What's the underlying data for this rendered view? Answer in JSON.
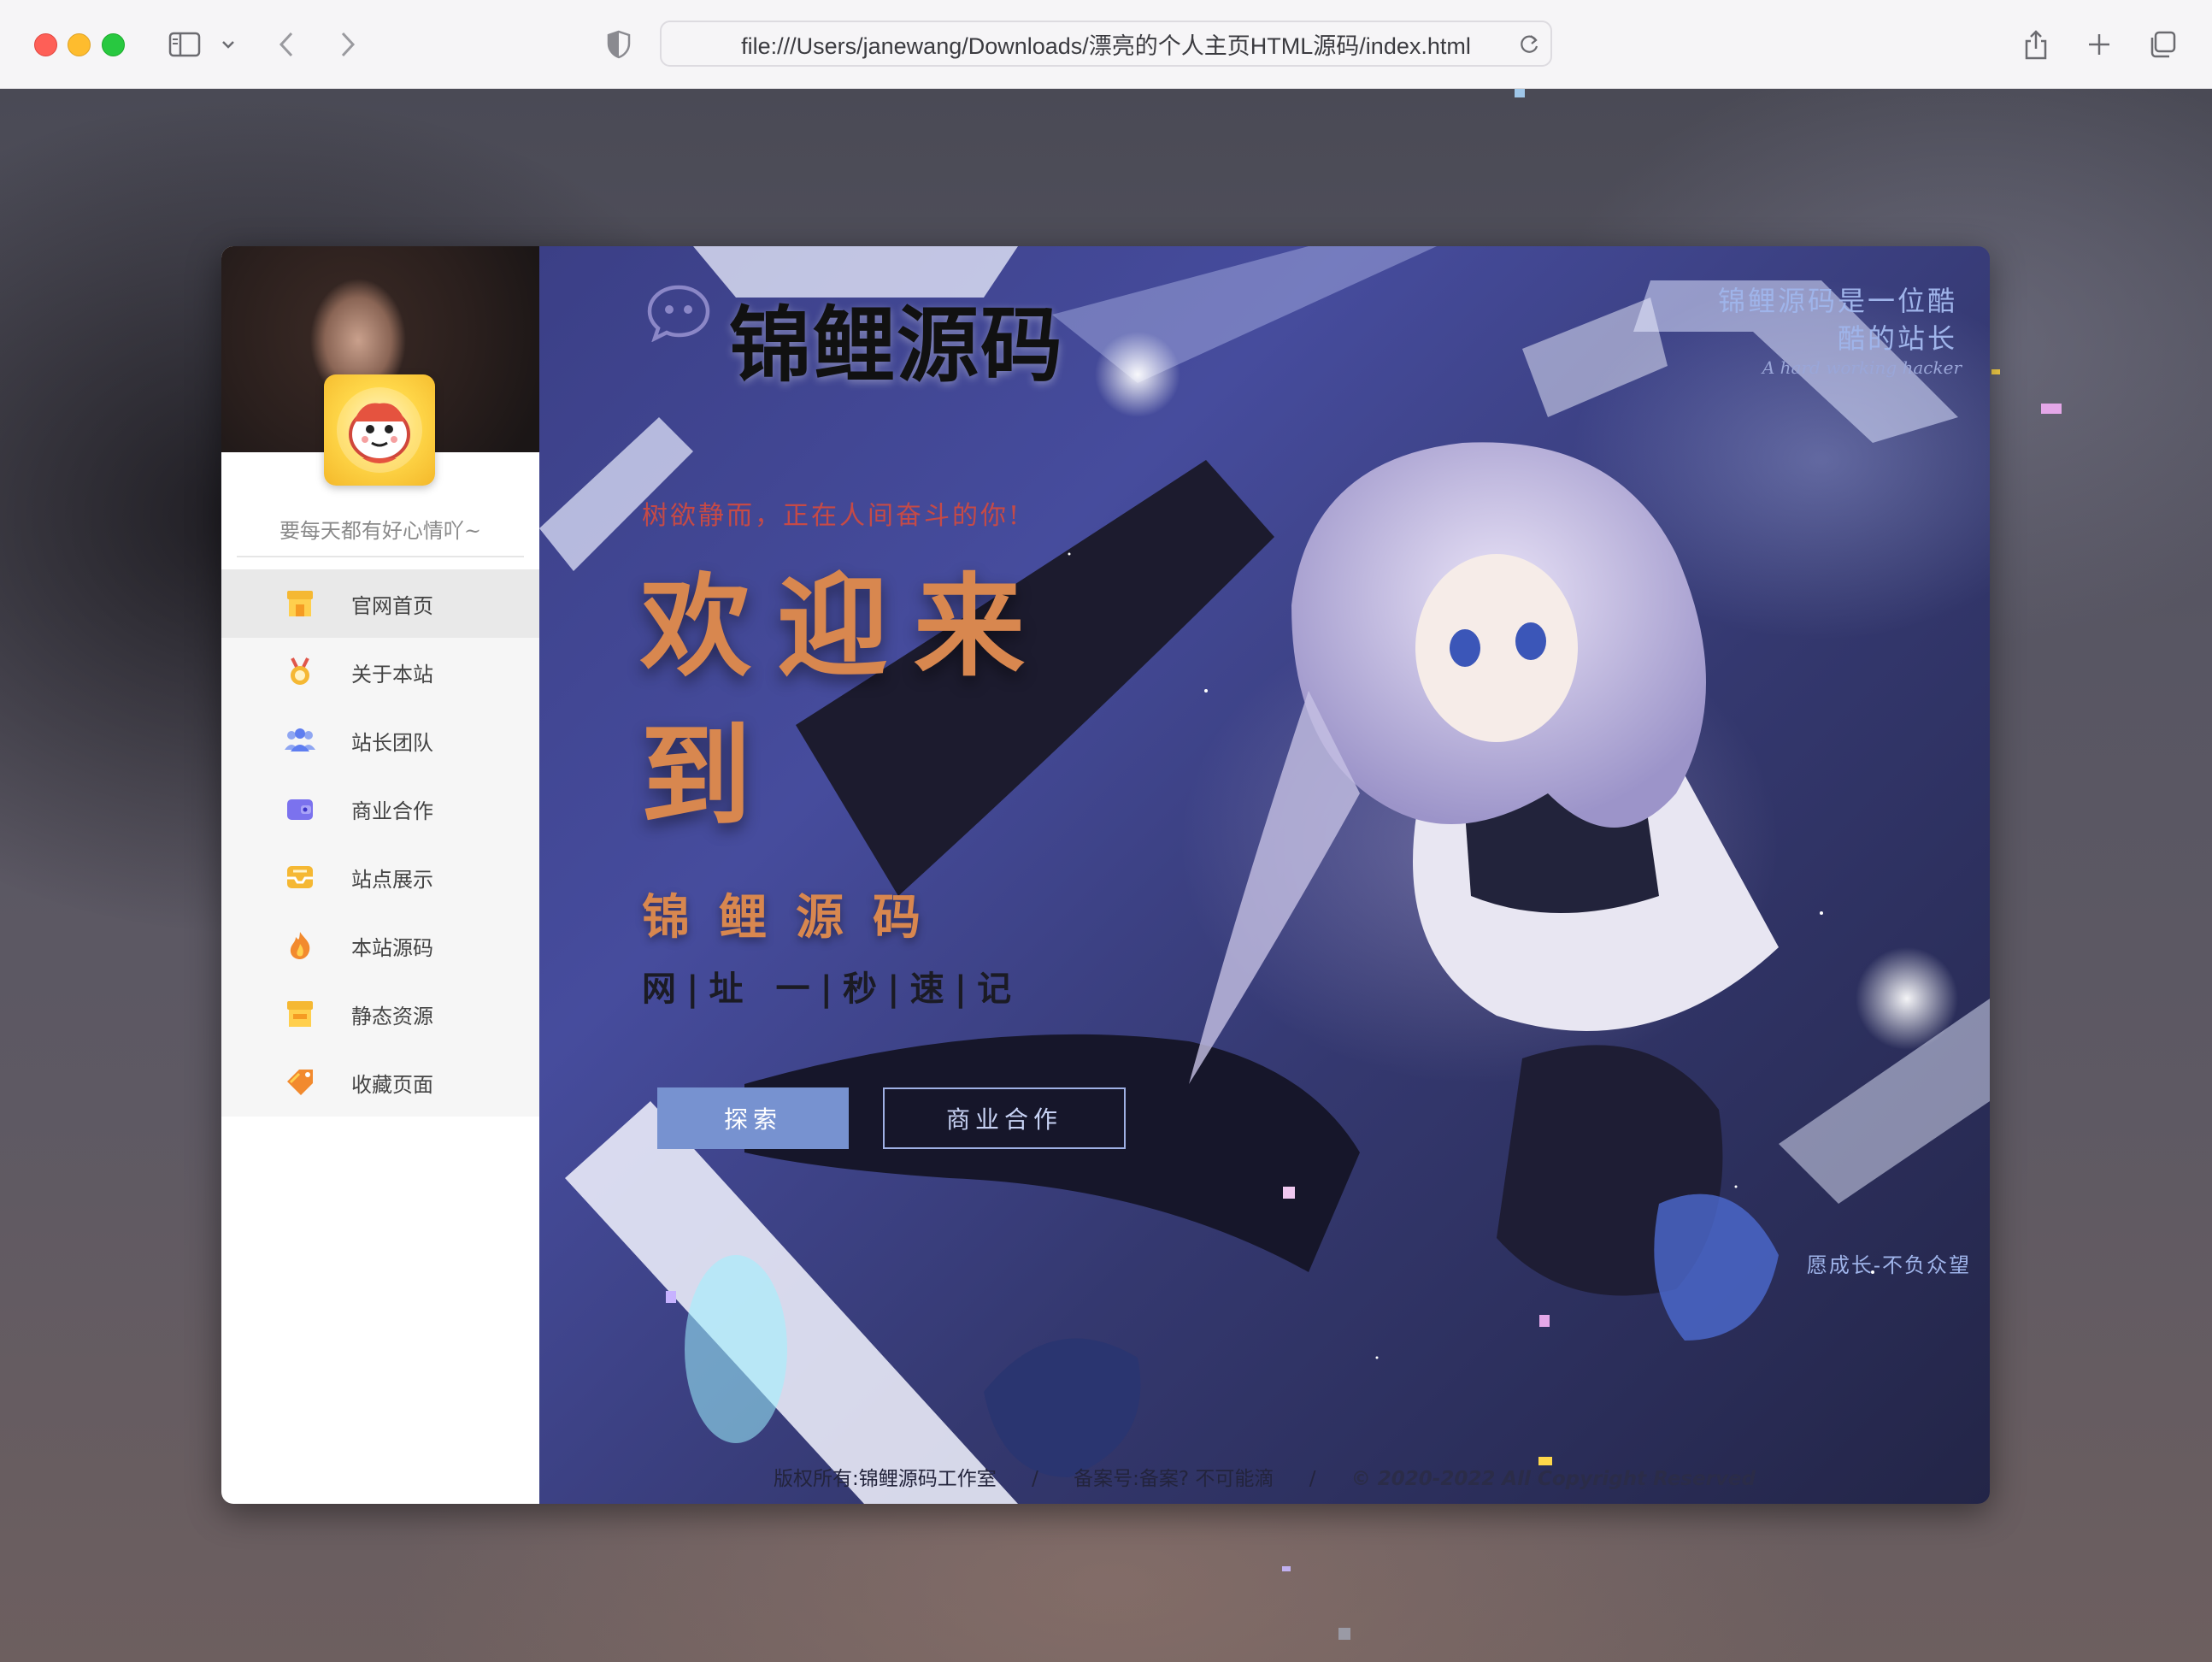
{
  "browser": {
    "url": "file:///Users/janewang/Downloads/漂亮的个人主页HTML源码/index.html"
  },
  "sidebar": {
    "slogan": "要每天都有好心情吖~",
    "items": [
      {
        "label": "官网首页",
        "icon": "shop-icon",
        "active": true
      },
      {
        "label": "关于本站",
        "icon": "medal-icon"
      },
      {
        "label": "站长团队",
        "icon": "team-icon"
      },
      {
        "label": "商业合作",
        "icon": "wallet-icon"
      },
      {
        "label": "站点展示",
        "icon": "inbox-icon"
      },
      {
        "label": "本站源码",
        "icon": "fire-icon"
      },
      {
        "label": "静态资源",
        "icon": "store-icon"
      },
      {
        "label": "收藏页面",
        "icon": "tag-icon"
      }
    ]
  },
  "hero": {
    "brand": "锦鲤源码",
    "quote_line1": "锦鲤源码是一位酷",
    "quote_line2": "酷的站长",
    "quote_en": "A hard working hacker",
    "tagline": "树欲静而，正在人间奋斗的你!",
    "welcome": "欢迎来到",
    "sub_brand": "锦鲤源码",
    "url_line": "网|址 一|秒|速|记",
    "explore_button": "探索",
    "business_button": "商业合作",
    "motto": "愿成长-不负众望"
  },
  "footer": {
    "owner": "版权所有:锦鲤源码工作室",
    "separator": "/",
    "icp": "备案号:备案? 不可能滴",
    "copyright": "© 2020-2022 All Copyright Reserved"
  },
  "colors": {
    "accent": "#d8874f",
    "button": "#7792d0",
    "quote": "#9fb4ea"
  }
}
